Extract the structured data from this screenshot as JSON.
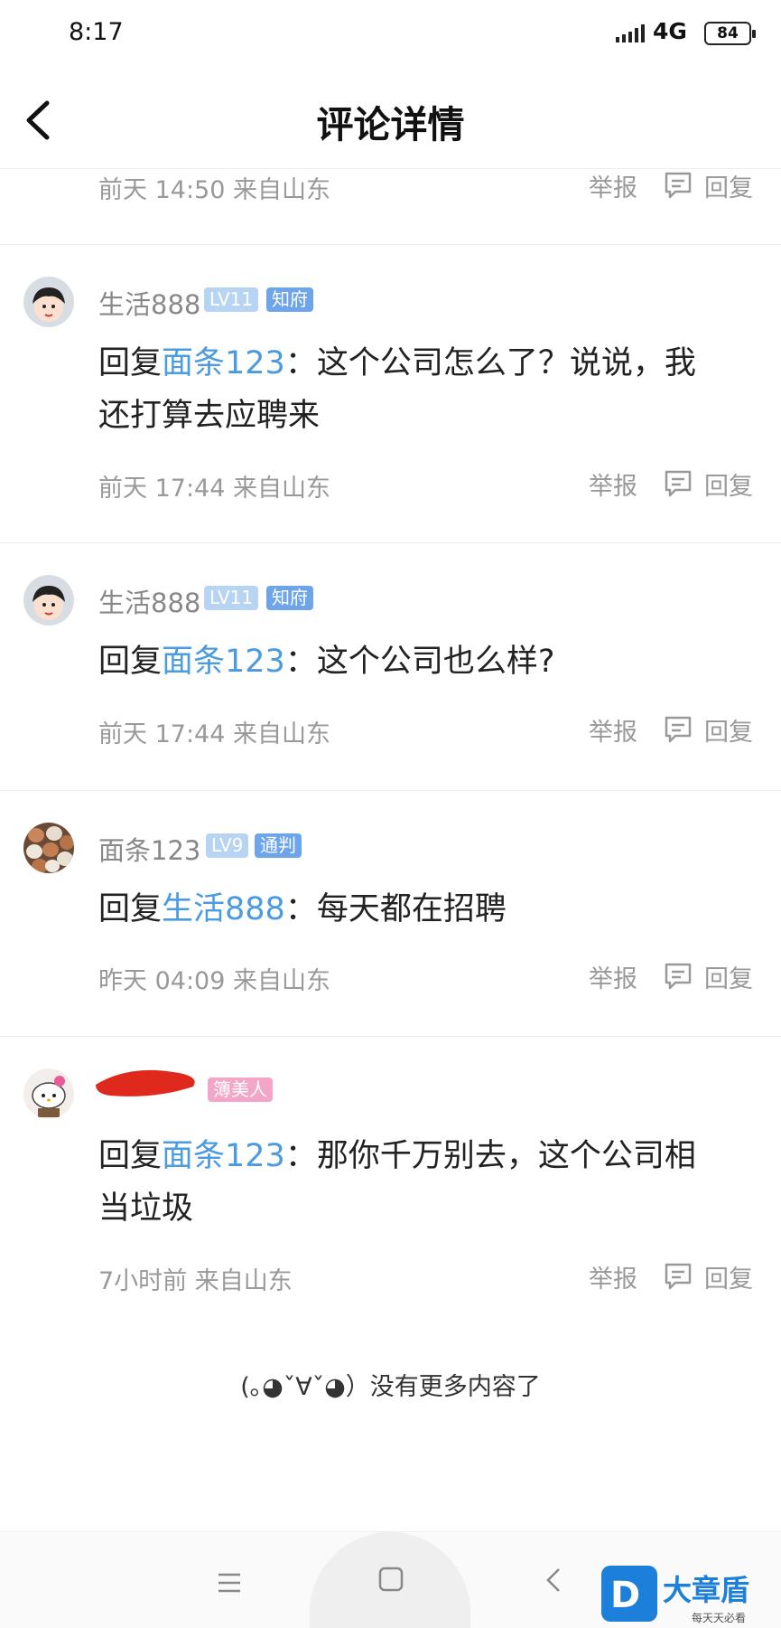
{
  "status": {
    "time": "8:17",
    "network": "4G",
    "battery": "84"
  },
  "header": {
    "title": "评论详情"
  },
  "top_meta": {
    "time": "前天 14:50",
    "location": "来自山东",
    "report": "举报",
    "reply": "回复"
  },
  "comments": [
    {
      "user": "生活888",
      "level": "LV11",
      "rank": "知府",
      "reply_prefix": "回复",
      "mention": "面条123",
      "colon": "：",
      "text_line1": "这个公司怎么了？说说，我",
      "text_line2": "还打算去应聘来",
      "time": "前天 17:44",
      "location": "来自山东"
    },
    {
      "user": "生活888",
      "level": "LV11",
      "rank": "知府",
      "reply_prefix": "回复",
      "mention": "面条123",
      "colon": "：",
      "text_line1": "这个公司也么样?",
      "time": "前天 17:44",
      "location": "来自山东"
    },
    {
      "user": "面条123",
      "level": "LV9",
      "rank": "通判",
      "reply_prefix": "回复",
      "mention": "生活888",
      "colon": "：",
      "text_line1": "每天都在招聘",
      "time": "昨天 04:09",
      "location": "来自山东"
    },
    {
      "rank": "簿美人",
      "reply_prefix": "回复",
      "mention": "面条123",
      "colon": "：",
      "text_line1": "那你千万别去，这个公司相",
      "text_line2": "当垃圾",
      "time": "7小时前",
      "location": "来自山东"
    }
  ],
  "action_labels": {
    "report": "举报",
    "reply": "回复"
  },
  "footer": {
    "no_more": "(｡◕ˇ∀ˇ◕）没有更多内容了"
  },
  "watermark": {
    "text": "大章盾",
    "sub": "每天天必看"
  }
}
